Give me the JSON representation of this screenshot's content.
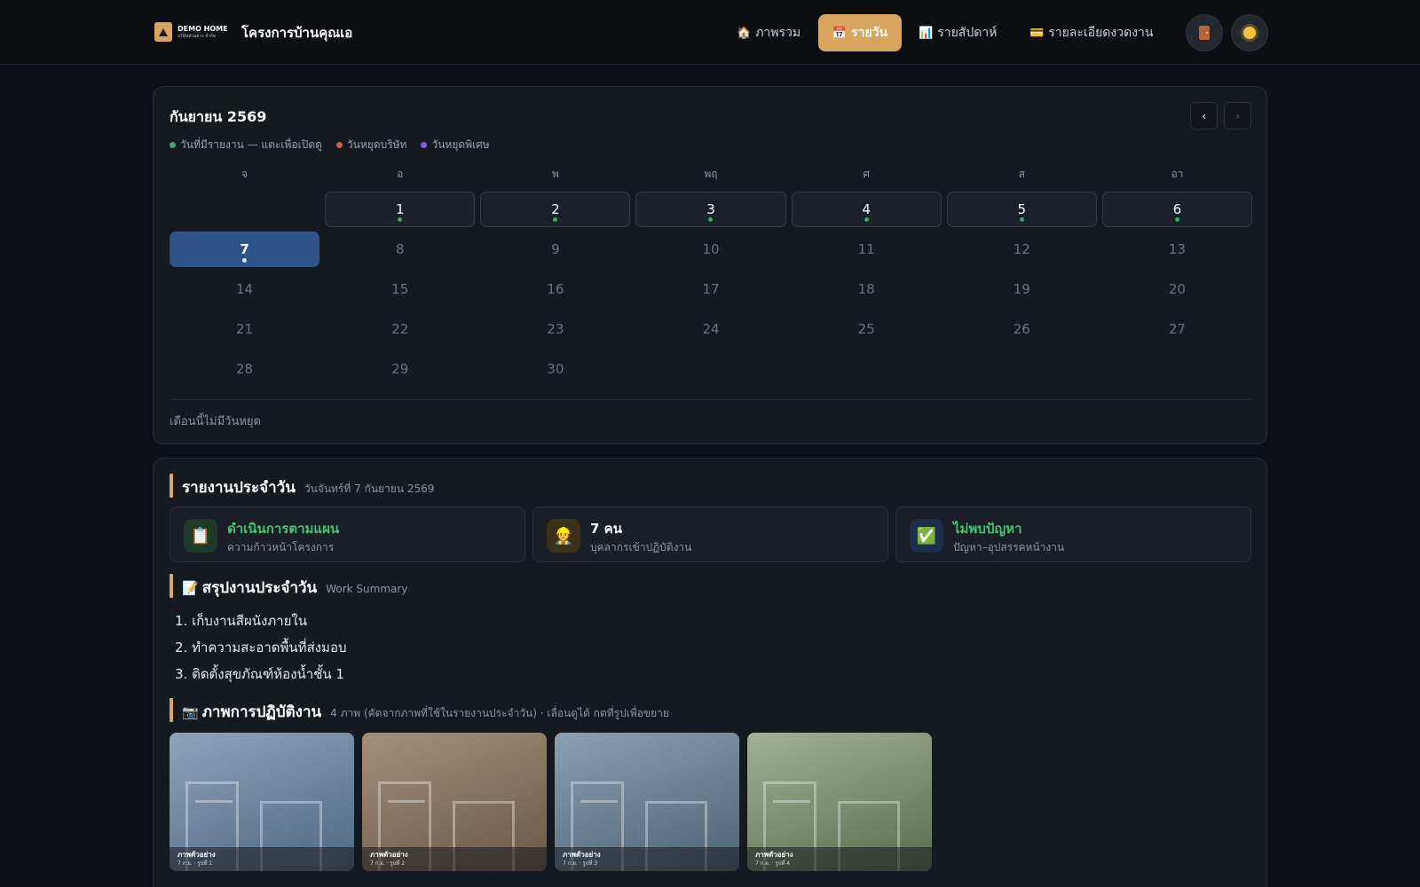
{
  "header": {
    "brand_name": "DEMO HOME",
    "brand_sub": "บริษัทตัวอย่าง จำกัด",
    "project_title": "โครงการบ้านคุณเอ",
    "nav": [
      {
        "icon": "🏠",
        "label": "ภาพรวม"
      },
      {
        "icon": "📅",
        "label": "รายวัน",
        "active": true
      },
      {
        "icon": "📊",
        "label": "รายสัปดาห์"
      },
      {
        "icon": "💳",
        "label": "รายละเอียดงวดงาน"
      }
    ],
    "exit_icon": "door-icon",
    "theme_icon": "sun-icon"
  },
  "calendar": {
    "title": "กันยายน 2569",
    "prev": "‹",
    "next": "›",
    "legend": [
      {
        "label": "วันที่มีรายงาน — แตะเพื่อเปิดดู",
        "color": "#3aa863"
      },
      {
        "label": "วันหยุดบริษัท",
        "color": "#d0643f"
      },
      {
        "label": "วันหยุดพิเศษ",
        "color": "#8a5ad8"
      }
    ],
    "weekdays": [
      "จ",
      "อ",
      "พ",
      "พฤ",
      "ศ",
      "ส",
      "อา"
    ],
    "first_weekday_offset": 1,
    "days_in_month": 30,
    "report_days": [
      1,
      2,
      3,
      4,
      5,
      6,
      7
    ],
    "selected_day": 7,
    "holiday_note": "เดือนนี้ไม่มีวันหยุด"
  },
  "report": {
    "title": "รายงานประจำวัน",
    "date": "วันจันทร์ที่ 7 กันยายน 2569",
    "stats": [
      {
        "icon": "📋",
        "icon_bg": "#1d3a28",
        "value": "ดำเนินการตามแผน",
        "value_color": "#3ec46d",
        "label": "ความก้าวหน้าโครงการ"
      },
      {
        "icon": "👷",
        "icon_bg": "#3a3218",
        "value": "7 คน",
        "value_color": "#ffffff",
        "label": "บุคลากรเข้าปฏิบัติงาน"
      },
      {
        "icon": "✅",
        "icon_bg": "#1b2e4a",
        "value": "ไม่พบปัญหา",
        "value_color": "#3ec46d",
        "label": "ปัญหา–อุปสรรคหน้างาน"
      }
    ],
    "summary": {
      "icon": "📝",
      "title": "สรุปงานประจำวัน",
      "sub": "Work Summary",
      "items": [
        "1. เก็บงานสีผนังภายใน",
        "2. ทำความสะอาดพื้นที่ส่งมอบ",
        "3. ติดตั้งสุขภัณฑ์ห้องน้ำชั้น 1"
      ]
    },
    "photos_section": {
      "icon": "📷",
      "title": "ภาพการปฏิบัติงาน",
      "sub": "4 ภาพ (คัดจากภาพที่ใช้ในรายงานประจำวัน) · เลื่อนดูได้ กดที่รูปเพื่อขยาย",
      "items": [
        {
          "title": "ภาพตัวอย่าง",
          "caption": "7 ก.ย. · รูปที่ 1",
          "c1": "#8ea3ba",
          "c2": "#4f6782"
        },
        {
          "title": "ภาพตัวอย่าง",
          "caption": "7 ก.ย. · รูปที่ 2",
          "c1": "#a38f7b",
          "c2": "#6b5747"
        },
        {
          "title": "ภาพตัวอย่าง",
          "caption": "7 ก.ย. · รูปที่ 3",
          "c1": "#8aa0b2",
          "c2": "#4d6275"
        },
        {
          "title": "ภาพตัวอย่าง",
          "caption": "7 ก.ย. · รูปที่ 4",
          "c1": "#a3b095",
          "c2": "#5c6b4e"
        }
      ]
    }
  }
}
